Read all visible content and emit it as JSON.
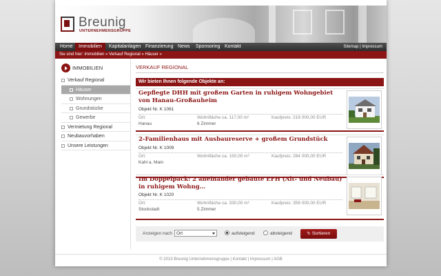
{
  "brand": {
    "name": "Breunig",
    "sub": "UNTERNEHMENSGRUPPE",
    "accent": "#8b1414"
  },
  "nav": {
    "items": [
      {
        "label": "Home",
        "active": false
      },
      {
        "label": "Immobilien",
        "active": true
      },
      {
        "label": "Kapitalanlagen",
        "active": false
      },
      {
        "label": "Finanzierung",
        "active": false
      },
      {
        "label": "News",
        "active": false
      },
      {
        "label": "Sponsoring",
        "active": false
      },
      {
        "label": "Kontakt",
        "active": false
      }
    ],
    "sitemap": "Sitemap",
    "separator": " | ",
    "impressum": "Impressum"
  },
  "breadcrumb": {
    "prefix": "Sie sind hier:",
    "items": [
      "Immobilien",
      "Verkauf Regional",
      "Häuser"
    ],
    "separator": "»"
  },
  "sidebar": {
    "heading": "IMMOBILIEN",
    "items": [
      {
        "label": "Verkauf Regional",
        "sub": false,
        "active": false
      },
      {
        "label": "Häuser",
        "sub": true,
        "active": true
      },
      {
        "label": "Wohnungen",
        "sub": true,
        "active": false
      },
      {
        "label": "Grundstücke",
        "sub": true,
        "active": false
      },
      {
        "label": "Gewerbe",
        "sub": true,
        "active": false
      },
      {
        "label": "Vermietung Regional",
        "sub": false,
        "active": false
      },
      {
        "label": "Neubauvorhaben",
        "sub": false,
        "active": false
      },
      {
        "label": "Unsere Leistungen",
        "sub": false,
        "active": false
      }
    ]
  },
  "main": {
    "title": "VERKAUF REGIONAL",
    "offer_heading": "Wir bieten Ihnen folgende Objekte an:",
    "listings": [
      {
        "title": "Gepflegte DHH mit großem Garten in ruhigem Wohngebiet von Hanau-Großauheim",
        "objnr": "Objekt Nr. K 1061",
        "ort_label": "Ort:",
        "ort": "Hanau",
        "wohnflaeche": "Wohnfläche ca. 117,00 m²",
        "zimmer": "6 Zimmer",
        "kaufpreis": "Kaufpreis: 219 000,00 EUR",
        "thumb": "house-white-icon"
      },
      {
        "title": "2-Familienhaus mit Ausbaureserve + großem Grundstück",
        "objnr": "Objekt Nr. K 1009",
        "ort_label": "Ort:",
        "ort": "Kahl a. Main",
        "wohnflaeche": "Wohnfläche ca. 150,00 m²",
        "zimmer": "",
        "kaufpreis": "Kaufpreis: 284 000,00 EUR",
        "thumb": "house-two-family-icon"
      },
      {
        "title": "Im Doppelpack: 2 aneinander gebaute EFH (Alt- und Neubau) in ruhigem Wohng…",
        "objnr": "Objekt Nr. K 1020",
        "ort_label": "Ort:",
        "ort": "Stockstadt",
        "wohnflaeche": "Wohnfläche ca. 330,00 m²",
        "zimmer": "5 Zimmer",
        "kaufpreis": "Kaufpreis: 359 000,00 EUR",
        "thumb": "interior-room-icon"
      }
    ],
    "sort": {
      "label": "Anzeigen nach",
      "selected": "Ort",
      "asc": "aufsteigend",
      "desc": "absteigend",
      "asc_selected": true,
      "button": "Sortieren"
    }
  },
  "footer": {
    "copyright": "© 2013 Breunig Unternehmensgruppe",
    "links": [
      "Kontakt",
      "Impressum",
      "AGB"
    ],
    "separator": " | "
  }
}
